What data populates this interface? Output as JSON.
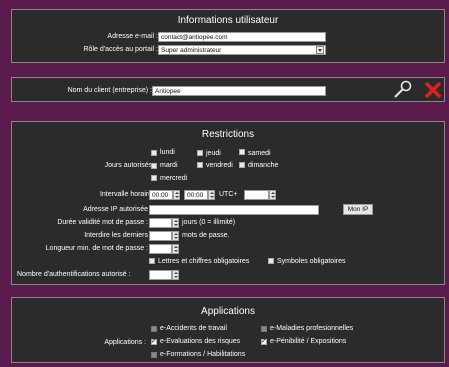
{
  "user_info": {
    "title": "Informations utilisateur",
    "email_label": "Adresse e-mail :",
    "email_value": "contact@antiopee.com",
    "role_label": "Rôle d'accès au portail :",
    "role_value": "Super administrateur"
  },
  "client": {
    "label": "Nom du client (entreprise) :",
    "value": "Antiopee",
    "icons": [
      "search-icon",
      "delete-icon"
    ]
  },
  "restrictions": {
    "title": "Restrictions",
    "days_label": "Jours autorisés :",
    "days": [
      {
        "label": "lundi",
        "checked": false
      },
      {
        "label": "jeudi",
        "checked": false
      },
      {
        "label": "samedi",
        "checked": false
      },
      {
        "label": "mardi",
        "checked": false
      },
      {
        "label": "vendredi",
        "checked": false
      },
      {
        "label": "dimanche",
        "checked": false
      },
      {
        "label": "mercredi",
        "checked": false
      }
    ],
    "hours_label": "Intervalle horaire :",
    "hour_start": "00:00",
    "hour_end": "00:00",
    "utc_label": "UTC+",
    "utc_value": "",
    "ip_label": "Adresse IP autorisée",
    "ip_value": "",
    "my_ip_button": "Mon IP",
    "pwd_validity_label": "Durée validité mot de passe :",
    "pwd_validity_value": "",
    "pwd_validity_suffix": "jours (0 = illimité)",
    "forbid_last_label": "Interdire les derniers",
    "forbid_last_value": "",
    "forbid_last_suffix": "mots de passe.",
    "pwd_minlen_label": "Longueur min. de mot de passe :",
    "pwd_minlen_value": "",
    "letters_digits_label": "Lettres et chiffres obligatoires",
    "symbols_label": "Symboles obligatoires",
    "auth_count_label": "Nombre d'authentifications autorisé :",
    "auth_count_value": ""
  },
  "applications": {
    "title": "Applications",
    "label": "Applications :",
    "items": [
      {
        "label": "e-Accidents de travail",
        "checked": false,
        "disabled": true
      },
      {
        "label": "e-Maladies profesionnelles",
        "checked": false,
        "disabled": true
      },
      {
        "label": "e-Evaluations des risques",
        "checked": true,
        "disabled": false
      },
      {
        "label": "e-Pénibilité / Expositions",
        "checked": true,
        "disabled": false
      },
      {
        "label": "e-Formations / Habilitations",
        "checked": false,
        "disabled": true
      }
    ]
  }
}
